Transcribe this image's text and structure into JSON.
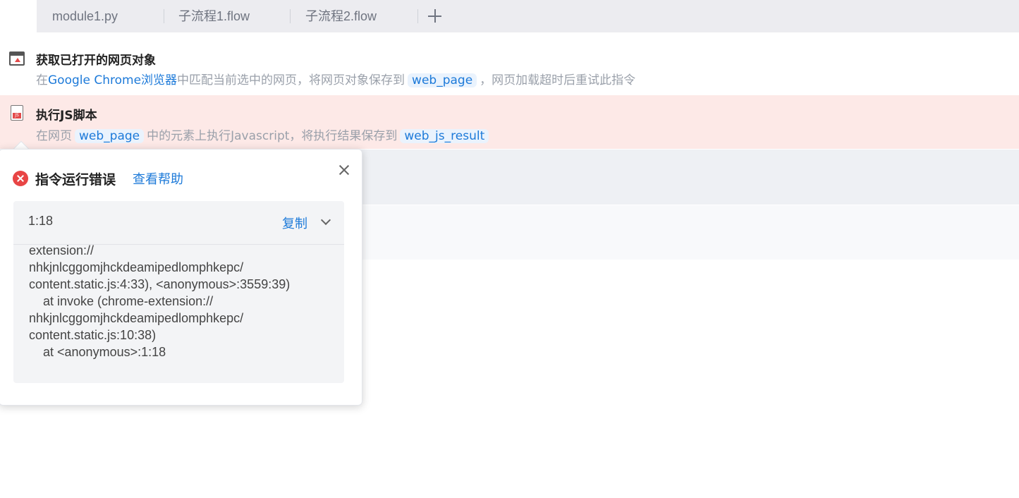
{
  "tabs": [
    {
      "label": "module1.py"
    },
    {
      "label": "子流程1.flow"
    },
    {
      "label": "子流程2.flow"
    }
  ],
  "steps": [
    {
      "title": "获取已打开的网页对象",
      "desc": {
        "pre": "在",
        "browser": "Google Chrome浏览器",
        "mid": "中匹配当前选中的网页，将网页对象保存到",
        "var": "web_page",
        "post": "，网页加载超时后重试此指令"
      }
    },
    {
      "title": "执行JS脚本",
      "desc": {
        "pre": "在网页",
        "var1": "web_page",
        "mid": "中的元素上执行Javascript，将执行结果保存到",
        "var2": "web_js_result"
      }
    }
  ],
  "error_popover": {
    "title": "指令运行错误",
    "help_link": "查看帮助",
    "location": "1:18",
    "copy_label": "复制",
    "trace_lines": [
      "extension://",
      "nhkjnlcggomjhckdeamipedlomphkepc/",
      "content.static.js:4:33), <anonymous>:3559:39)",
      "    at invoke (chrome-extension://",
      "nhkjnlcggomjhckdeamipedlomphkepc/",
      "content.static.js:10:38)",
      "    at <anonymous>:1:18"
    ]
  }
}
